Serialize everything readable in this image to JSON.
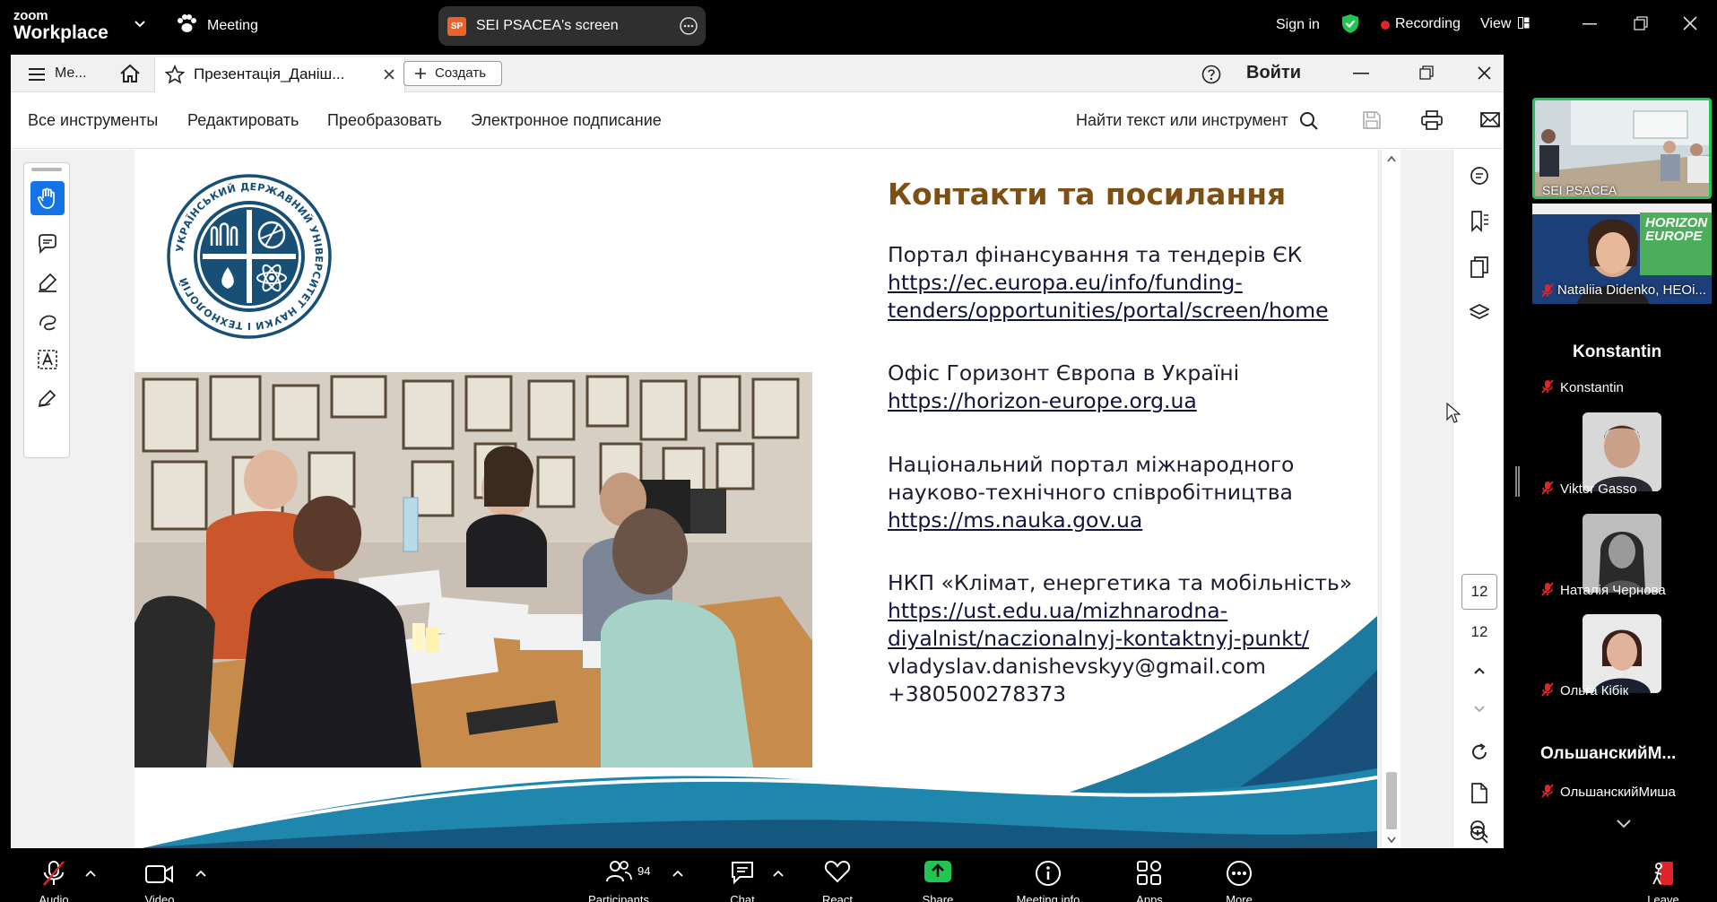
{
  "zoom": {
    "logo_top": "zoom",
    "logo_bottom": "Workplace",
    "meeting_label": "Meeting",
    "share_badge": "SP",
    "share_label": "SEI PSACEA's screen",
    "sign_in": "Sign in",
    "recording": "Recording",
    "view": "View"
  },
  "acrobat": {
    "menu_label": "Me...",
    "tab_title": "Презентація_Даніш...",
    "create_label": "Создать",
    "login_label": "Войти",
    "menu_items": [
      "Все инструменты",
      "Редактировать",
      "Преобразовать",
      "Электронное подписание"
    ],
    "search_label": "Найти текст или инструмент",
    "page_current": "12",
    "page_total": "12"
  },
  "slide": {
    "title": "Контакти та посилання",
    "logo_ring_text": "УКРАЇНСЬКИЙ ДЕРЖАВНИЙ УНІВЕРСИТЕТ НАУКИ І ТЕХНОЛОГІЙ",
    "items": [
      {
        "label": "Портал фінансування та тендерів ЄК",
        "link1": "https://ec.europa.eu/info/funding-",
        "link2": "tenders/opportunities/portal/screen/home"
      },
      {
        "label": "Офіс Горизонт Європа в Україні",
        "link1": "https://horizon-europe.org.ua"
      },
      {
        "label": "Національний портал міжнародного",
        "label2": "науково-технічного співробітництва",
        "link1": "https://ms.nauka.gov.ua"
      },
      {
        "label": "НКП «Клімат, енергетика та мобільність»",
        "link1": "https://ust.edu.ua/mizhnarodna-",
        "link2": "diyalnist/naczionalnyj-kontaktnyj-punkt/",
        "email": "vladyslav.danishevskyy@gmail.com",
        "phone": "+380500278373"
      }
    ]
  },
  "participants": {
    "tile1": "SEI PSACEA",
    "tile2": "Nataliia Didenko, HEOi...",
    "tile2_banner": "HORIZON EUROPE",
    "konstantin_big": "Konstantin",
    "konstantin": "Konstantin",
    "viktor": "Viktor Gasso",
    "natalia": "Наталія Чернова",
    "olga": "Ольга Кібік",
    "olshansky_big": "ОльшанскийМ...",
    "olshansky": "ОльшанскийМиша"
  },
  "toolbar": {
    "audio": "Audio",
    "video": "Video",
    "participants_label": "Participants",
    "participants_count": "94",
    "chat": "Chat",
    "react": "React",
    "share": "Share",
    "meeting_info": "Meeting info",
    "apps": "Apps",
    "more": "More",
    "leave": "Leave"
  },
  "colors": {
    "title_brown": "#7d4f12",
    "wave_blue": "#1c79a0",
    "share_green": "#23c552",
    "recording_red": "#e0242b",
    "active_tool_blue": "#1473e6"
  }
}
